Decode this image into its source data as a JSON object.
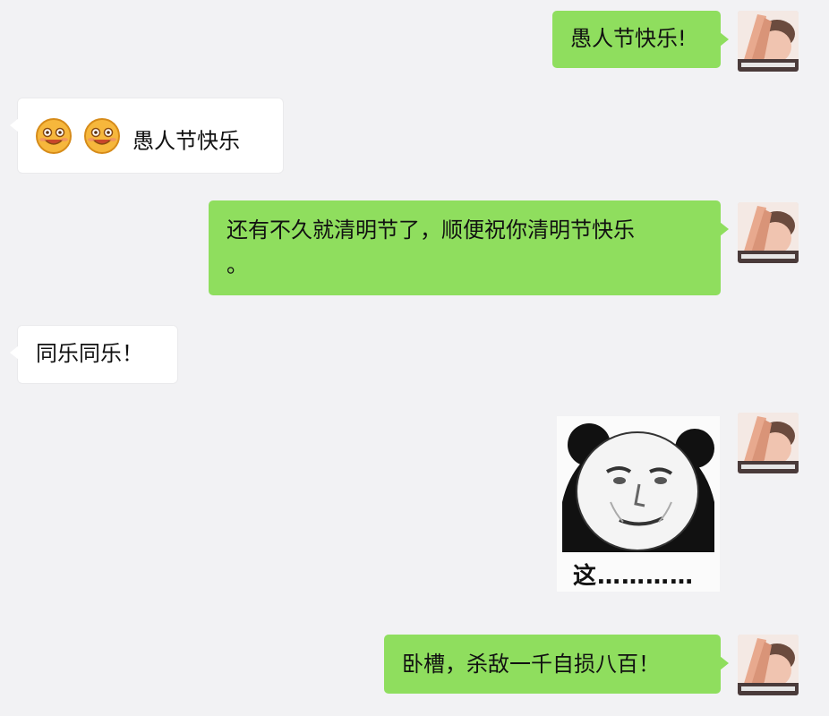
{
  "messages": [
    {
      "from": "me",
      "text": "愚人节快乐!"
    },
    {
      "from": "other",
      "emoji": [
        "grinning-face-emoji",
        "grinning-face-emoji"
      ],
      "text": "愚人节快乐"
    },
    {
      "from": "me",
      "line1": "还有不久就清明节了，顺便祝你清明节快乐",
      "line2": "。"
    },
    {
      "from": "other",
      "text": "同乐同乐！"
    },
    {
      "from": "me",
      "sticker": "panda-meme-sticker",
      "caption": "这…………"
    },
    {
      "from": "me",
      "text": "卧槽，杀敌一千自损八百！"
    }
  ],
  "colors": {
    "background": "#f2f2f4",
    "my_bubble": "#8fde5e",
    "other_bubble": "#ffffff"
  }
}
